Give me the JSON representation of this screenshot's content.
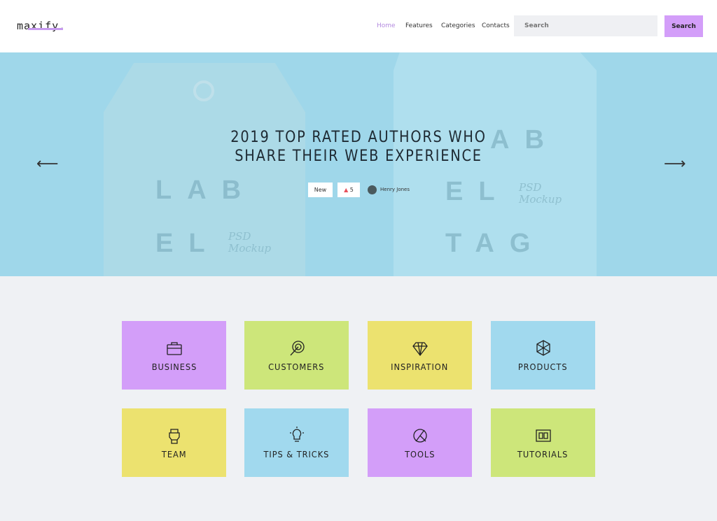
{
  "header": {
    "logo": "maxify.",
    "nav": [
      {
        "label": "Home",
        "active": true
      },
      {
        "label": "Features"
      },
      {
        "label": "Categories"
      },
      {
        "label": "Contacts"
      }
    ],
    "search": {
      "placeholder": "Search",
      "button": "Search"
    }
  },
  "hero": {
    "title_line1": "2019 TOP RATED AUTHORS WHO",
    "title_line2": "SHARE THEIR WEB EXPERIENCE",
    "badge": "New",
    "likes": "5",
    "author": "Henry Jones",
    "bg_text": {
      "left1": "LAB",
      "left2": "EL",
      "right1": "AB",
      "right2": "EL",
      "right3": "TAG",
      "psd": "PSD",
      "mockup": "Mockup"
    }
  },
  "categories": [
    {
      "label": "BUSINESS",
      "color": "#d39ef9",
      "icon": "briefcase-icon"
    },
    {
      "label": "CUSTOMERS",
      "color": "#cde67a",
      "icon": "target-icon"
    },
    {
      "label": "INSPIRATION",
      "color": "#ece26f",
      "icon": "diamond-icon"
    },
    {
      "label": "PRODUCTS",
      "color": "#a1d9ee",
      "icon": "cube-icon"
    },
    {
      "label": "TEAM",
      "color": "#ece26f",
      "icon": "hand-icon"
    },
    {
      "label": "TIPS & TRICKS",
      "color": "#a1d9ee",
      "icon": "lightbulb-icon"
    },
    {
      "label": "TOOLS",
      "color": "#d39ef9",
      "icon": "compass-icon"
    },
    {
      "label": "TUTORIALS",
      "color": "#cde67a",
      "icon": "book-icon"
    }
  ],
  "colors": {
    "accent": "#d39ef9",
    "hero": "#9fd7ea"
  }
}
